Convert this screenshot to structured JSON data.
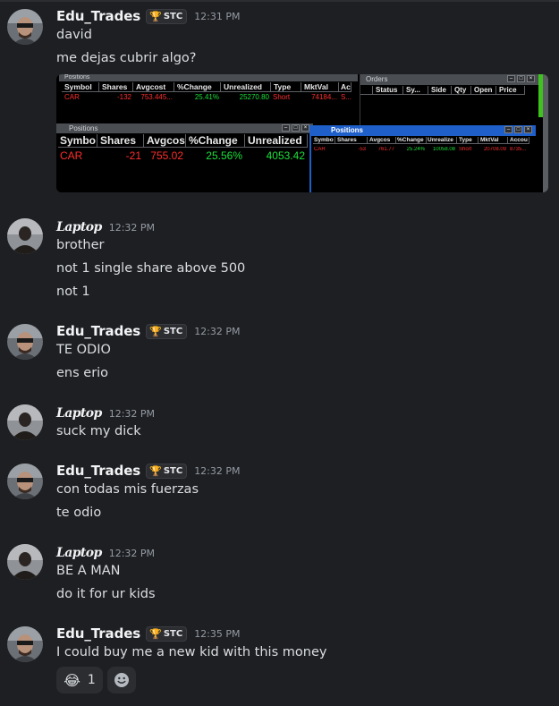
{
  "messages": [
    {
      "author": "Edu_Trades",
      "tag": "STC",
      "time": "12:31 PM",
      "lines": [
        "david",
        "me dejas cubrir algo?"
      ],
      "avatar": "man-sunglasses-avatar"
    },
    {
      "author": "Laptop",
      "time": "12:32 PM",
      "lines": [
        "brother",
        "not 1 single share above 500",
        "not 1"
      ],
      "avatar": "dark-figure-avatar"
    },
    {
      "author": "Edu_Trades",
      "tag": "STC",
      "time": "12:32 PM",
      "lines": [
        "TE ODIO",
        "ens erio"
      ],
      "avatar": "man-sunglasses-avatar"
    },
    {
      "author": "Laptop",
      "time": "12:32 PM",
      "lines": [
        "suck my dick"
      ],
      "avatar": "dark-figure-avatar"
    },
    {
      "author": "Edu_Trades",
      "tag": "STC",
      "time": "12:32 PM",
      "lines": [
        "con todas mis fuerzas",
        "te odio"
      ],
      "avatar": "man-sunglasses-avatar"
    },
    {
      "author": "Laptop",
      "time": "12:32 PM",
      "lines": [
        "BE A MAN",
        "do it for ur kids"
      ],
      "avatar": "dark-figure-avatar"
    },
    {
      "author": "Edu_Trades",
      "tag": "STC",
      "time": "12:35 PM",
      "lines": [
        "I could buy me a new kid with this money"
      ],
      "avatar": "man-sunglasses-avatar"
    }
  ],
  "attachment": {
    "window_top_left": {
      "title": "Positions",
      "headers": [
        "Symbol",
        "Shares",
        "Avgcost",
        "%Change",
        "Unrealized",
        "Type",
        "MktVal",
        "Ac"
      ],
      "row": [
        "CAR",
        "-132",
        "753.445...",
        "25.41%",
        "25270.80",
        "Short",
        "74184...",
        "S..."
      ]
    },
    "window_orders": {
      "title": "Orders",
      "headers": [
        "Status",
        "Sy...",
        "Side",
        "Qty",
        "Open",
        "Price"
      ]
    },
    "window_mid": {
      "title": "Positions",
      "headers": [
        "Symbo",
        "Shares",
        "Avgcos",
        "%Change",
        "Unrealized"
      ],
      "row": [
        "CAR",
        "-21",
        "755.02",
        "25.56%",
        "4053.42"
      ]
    },
    "window_blue": {
      "title": "Positions",
      "headers": [
        "Symbo",
        "Shares",
        "Avgcos",
        "%Change",
        "Unrealize",
        "Type",
        "MktVal",
        "Accou"
      ],
      "row": [
        "CAR",
        "-53",
        "761.77",
        "25.24%",
        "10058.08",
        "Short",
        "20708.09",
        "8735..."
      ]
    }
  },
  "reactions": [
    {
      "emoji": "😂",
      "count": "1"
    }
  ],
  "colors": {
    "background": "#1e1f22",
    "username": "#f2f3f5",
    "timestamp": "#949ba4",
    "trophy": "#f0b232",
    "loss_red": "#ff2d2d",
    "gain_green": "#19e23a",
    "window_blue": "#1f5fc9"
  }
}
